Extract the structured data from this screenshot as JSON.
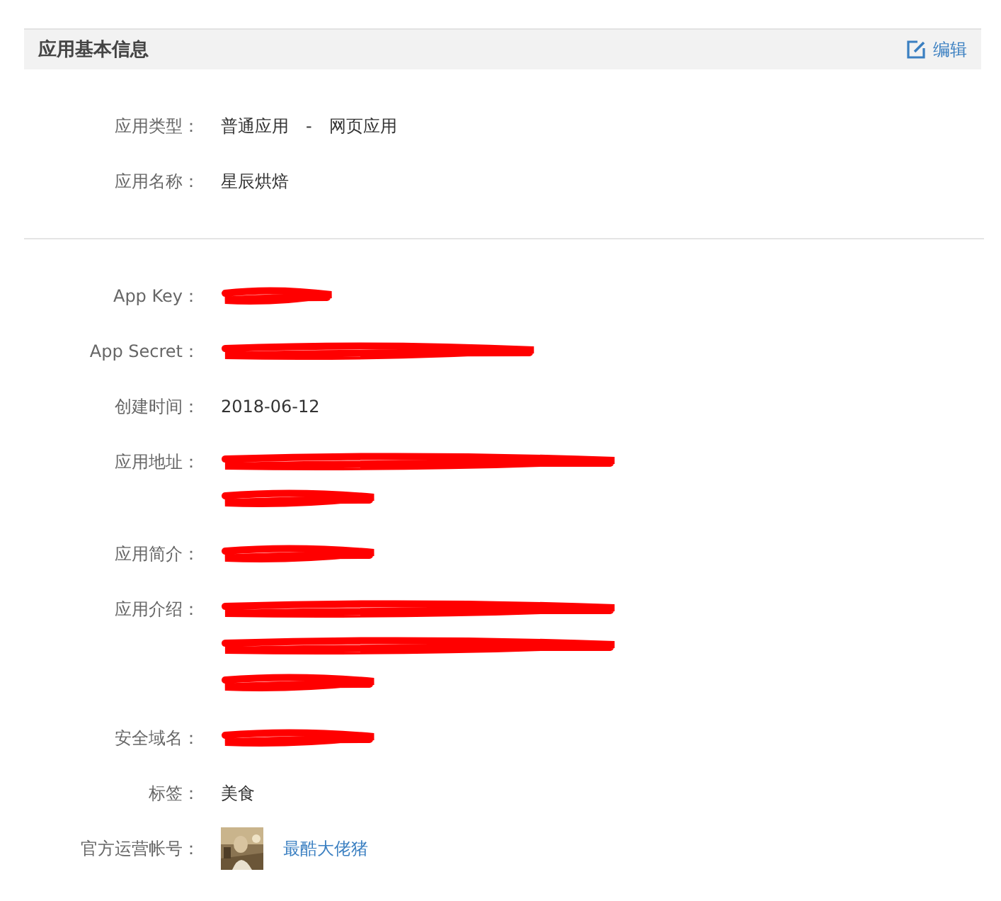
{
  "panel": {
    "title": "应用基本信息",
    "edit_link": "编辑"
  },
  "sections": [
    {
      "rows": [
        {
          "label": "应用类型：",
          "kind": "text",
          "value": "普通应用　-　网页应用"
        },
        {
          "label": "应用名称：",
          "kind": "text",
          "value": "星辰烘焙"
        }
      ]
    },
    {
      "rows": [
        {
          "label": "App Key：",
          "kind": "redacted",
          "lines": [
            {
              "kind": "tiny"
            }
          ]
        },
        {
          "label": "App Secret：",
          "kind": "redacted",
          "lines": [
            {
              "kind": "medium"
            }
          ]
        },
        {
          "label": "创建时间：",
          "kind": "text",
          "value": "2018-06-12"
        },
        {
          "label": "应用地址：",
          "kind": "redacted",
          "lines": [
            {
              "kind": "long"
            },
            {
              "kind": "short"
            }
          ]
        },
        {
          "label": "应用简介：",
          "kind": "redacted",
          "lines": [
            {
              "kind": "short"
            }
          ]
        },
        {
          "label": "应用介绍：",
          "kind": "redacted",
          "lines": [
            {
              "kind": "long"
            },
            {
              "kind": "long"
            },
            {
              "kind": "short"
            }
          ]
        },
        {
          "label": "安全域名：",
          "kind": "redacted",
          "lines": [
            {
              "kind": "short"
            }
          ]
        },
        {
          "label": "标签：",
          "kind": "text",
          "value": "美食"
        },
        {
          "label": "官方运营帐号：",
          "kind": "account",
          "value": "最酷大佬猪"
        }
      ]
    }
  ]
}
